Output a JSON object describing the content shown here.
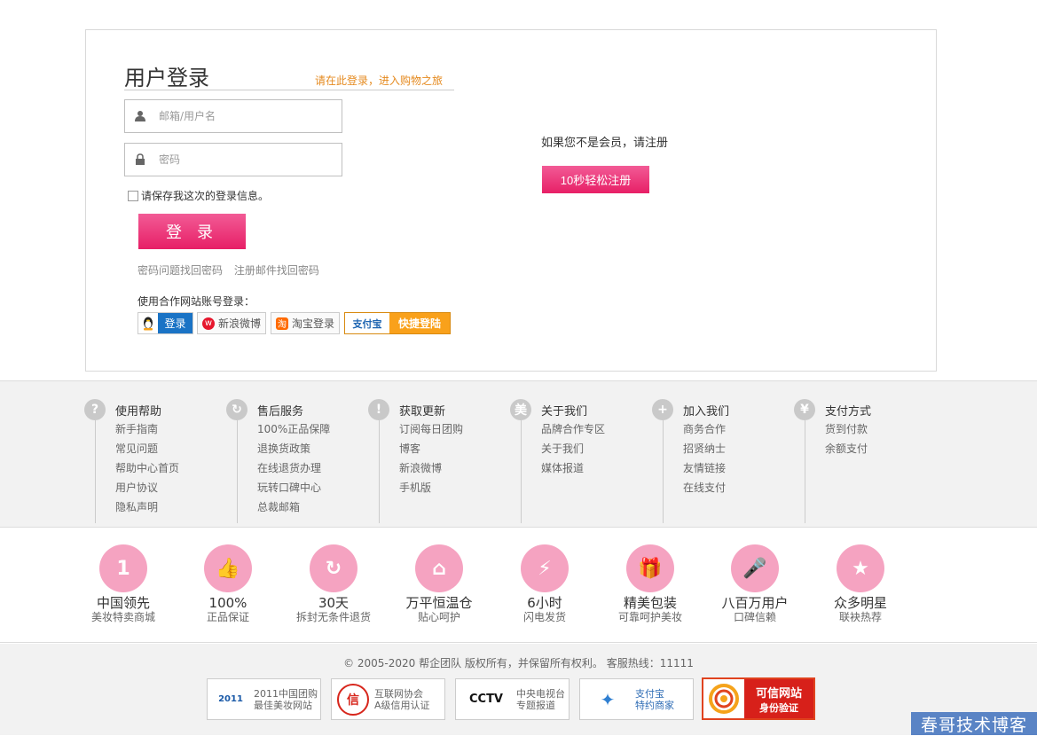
{
  "login": {
    "title": "用户登录",
    "hint": "请在此登录，进入购物之旅",
    "username_placeholder": "邮箱/用户名",
    "password_placeholder": "密码",
    "remember_label": "请保存我这次的登录信息。",
    "submit_label": "登 录",
    "find_by_question": "密码问题找回密码",
    "find_by_email": "注册邮件找回密码",
    "partner_label": "使用合作网站账号登录：",
    "partners": {
      "qq": "登录",
      "weibo": "新浪微博",
      "taobao": "淘宝登录",
      "alipay_logo": "支付宝",
      "alipay": "快捷登陆"
    }
  },
  "register": {
    "prompt": "如果您不是会员，请注册",
    "button_label": "10秒轻松注册"
  },
  "help_columns": [
    {
      "icon": "?",
      "title": "使用帮助",
      "links": [
        "新手指南",
        "常见问题",
        "帮助中心首页",
        "用户协议",
        "隐私声明"
      ]
    },
    {
      "icon": "↻",
      "title": "售后服务",
      "links": [
        "100%正品保障",
        "退换货政策",
        "在线退货办理",
        "玩转口碑中心",
        "总裁邮箱"
      ]
    },
    {
      "icon": "!",
      "title": "获取更新",
      "links": [
        "订阅每日团购",
        "博客",
        "新浪微博",
        "手机版"
      ]
    },
    {
      "icon": "美",
      "title": "关于我们",
      "links": [
        "品牌合作专区",
        "关于我们",
        "媒体报道"
      ]
    },
    {
      "icon": "+",
      "title": "加入我们",
      "links": [
        "商务合作",
        "招贤纳士",
        "友情链接",
        "在线支付"
      ]
    },
    {
      "icon": "¥",
      "title": "支付方式",
      "links": [
        "货到付款",
        "余额支付"
      ]
    }
  ],
  "features": [
    {
      "glyph": "1",
      "main": "中国领先",
      "sub": "美妆特卖商城"
    },
    {
      "glyph": "👍",
      "main": "100%",
      "sub": "正品保证"
    },
    {
      "glyph": "↻",
      "main": "30天",
      "sub": "拆封无条件退货"
    },
    {
      "glyph": "⌂",
      "main": "万平恒温仓",
      "sub": "贴心呵护"
    },
    {
      "glyph": "⚡",
      "main": "6小时",
      "sub": "闪电发货"
    },
    {
      "glyph": "🎁",
      "main": "精美包装",
      "sub": "可靠呵护美妆"
    },
    {
      "glyph": "🎤",
      "main": "八百万用户",
      "sub": "口碑信赖"
    },
    {
      "glyph": "★",
      "main": "众多明星",
      "sub": "联袂热荐"
    }
  ],
  "copyright": "© 2005-2020 帮企团队 版权所有，并保留所有权利。 客服热线：11111",
  "badges": [
    {
      "icon": "2011",
      "line1": "2011中国团购",
      "line2": "最佳美妆网站"
    },
    {
      "icon": "信",
      "line1": "互联网协会",
      "line2": "A级信用认证"
    },
    {
      "icon": "CCTV",
      "line1": "中央电视台",
      "line2": "专题报道"
    },
    {
      "icon": "✦",
      "line1": "支付宝",
      "line2": "特约商家"
    }
  ],
  "trust_badge": {
    "line1": "可信网站",
    "line2": "身份验证"
  },
  "watermark": "春哥技术博客",
  "colors": {
    "accent_pink": "#e71f66",
    "hint_orange": "#e58a1f",
    "qq_blue": "#1a73c5",
    "alipay_orange": "#f9a11b"
  }
}
